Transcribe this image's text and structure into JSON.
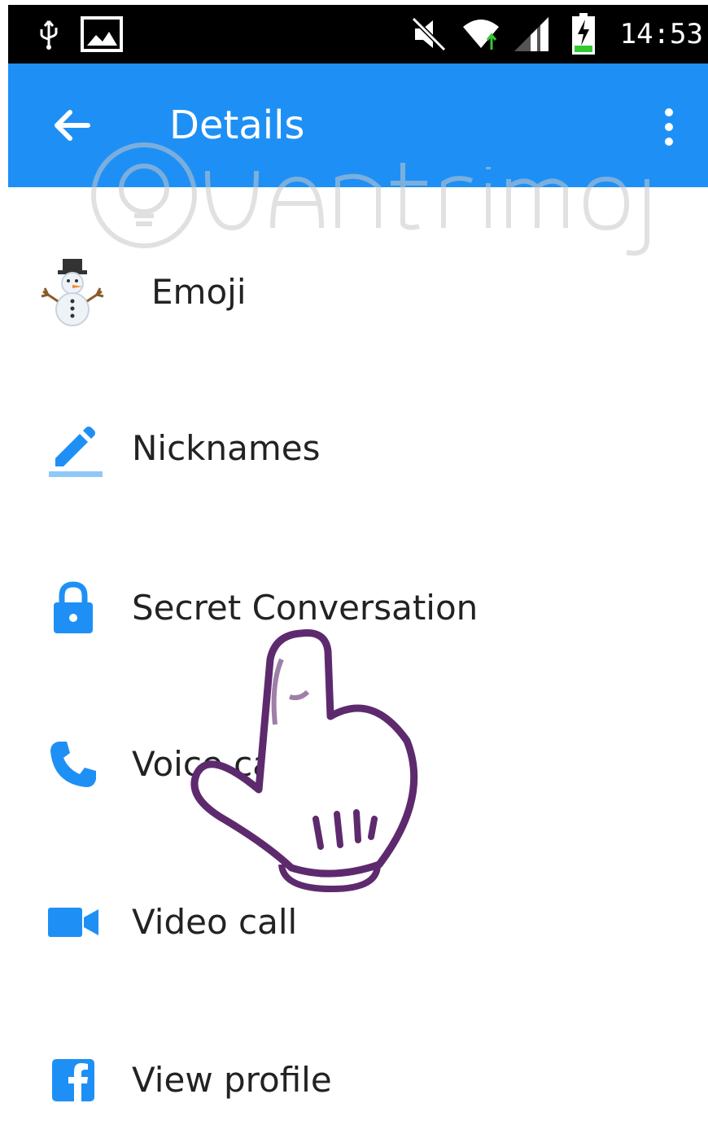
{
  "status_bar": {
    "time": "14:53",
    "icons": [
      "usb-icon",
      "image-notification-icon",
      "mute-icon",
      "wifi-icon",
      "signal-icon",
      "battery-charging-icon"
    ]
  },
  "app_bar": {
    "title": "Details",
    "accent_color": "#1e90f5"
  },
  "menu": {
    "items": [
      {
        "label": "Emoji",
        "icon": "snowman-emoji-icon"
      },
      {
        "label": "Nicknames",
        "icon": "pencil-icon"
      },
      {
        "label": "Secret Conversation",
        "icon": "lock-icon"
      },
      {
        "label": "Voice call",
        "icon": "phone-icon"
      },
      {
        "label": "Video call",
        "icon": "video-camera-icon"
      },
      {
        "label": "View profile",
        "icon": "facebook-icon"
      }
    ]
  },
  "overlay": {
    "watermark_icon": "quantrimang-watermark",
    "pointer_icon": "pointing-hand-icon"
  }
}
